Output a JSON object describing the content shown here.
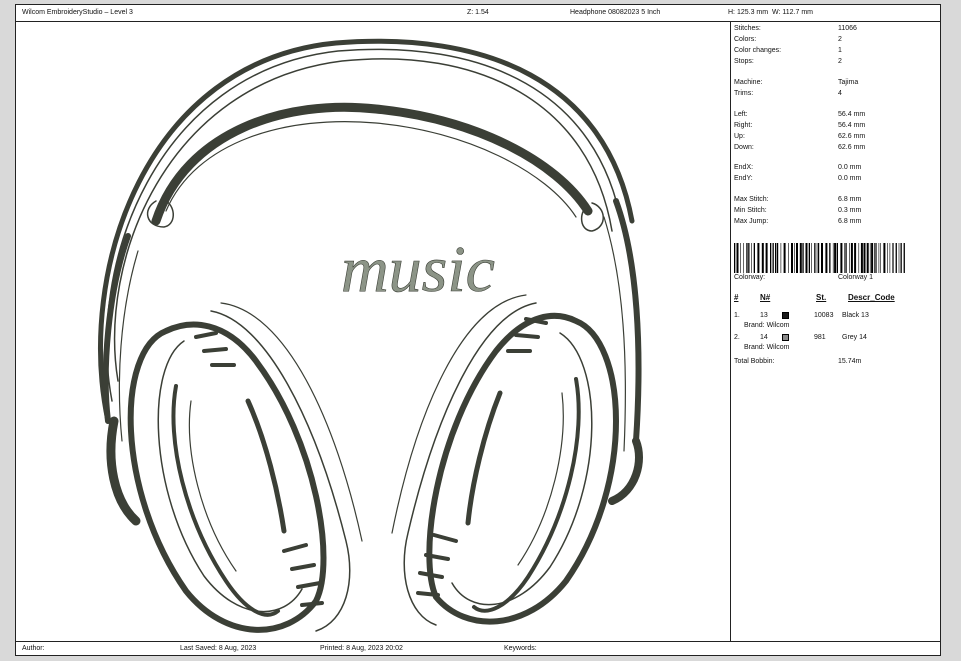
{
  "header": {
    "app_title": "Wilcom EmbroideryStudio – Level 3",
    "zoom": "Z: 1.54",
    "design_name": "Headphone 08082023 5 Inch",
    "height": "H: 125.3 mm",
    "width": "W: 112.7 mm"
  },
  "design": {
    "text": "music",
    "colors": {
      "dark": "#3b3f36",
      "grey": "#8c9487"
    }
  },
  "stats": [
    {
      "label": "Stitches:",
      "value": "11066"
    },
    {
      "label": "Colors:",
      "value": "2"
    },
    {
      "label": "Color changes:",
      "value": "1"
    },
    {
      "label": "Stops:",
      "value": "2"
    },
    {
      "label": "Machine:",
      "value": "Tajima"
    },
    {
      "label": "Trims:",
      "value": "4"
    },
    {
      "label": "Left:",
      "value": "56.4 mm"
    },
    {
      "label": "Right:",
      "value": "56.4 mm"
    },
    {
      "label": "Up:",
      "value": "62.6 mm"
    },
    {
      "label": "Down:",
      "value": "62.6 mm"
    },
    {
      "label": "EndX:",
      "value": "0.0 mm"
    },
    {
      "label": "EndY:",
      "value": "0.0 mm"
    },
    {
      "label": "Max Stitch:",
      "value": "6.8 mm"
    },
    {
      "label": "Min Stitch:",
      "value": "0.3 mm"
    },
    {
      "label": "Max Jump:",
      "value": "6.8 mm"
    }
  ],
  "colorway": {
    "label": "Colorway:",
    "value": "Colorway 1"
  },
  "thread_table": {
    "headers": {
      "num": "#",
      "n": "N#",
      "st": "St.",
      "descr": "Descr_Code"
    },
    "rows": [
      {
        "index": "1.",
        "n": "13",
        "color": "#1a1a1a",
        "st": "10083",
        "descr": "Black 13",
        "brand": "Brand: Wilcom"
      },
      {
        "index": "2.",
        "n": "14",
        "color": "#8a8a8a",
        "st": "981",
        "descr": "Grey 14",
        "brand": "Brand: Wilcom"
      }
    ],
    "total_bobbin_label": "Total Bobbin:",
    "total_bobbin_value": "15.74m"
  },
  "footer": {
    "author": "Author:",
    "last_saved": "Last Saved:  8 Aug, 2023",
    "printed": "Printed:  8 Aug, 2023 20:02",
    "keywords": "Keywords:"
  }
}
